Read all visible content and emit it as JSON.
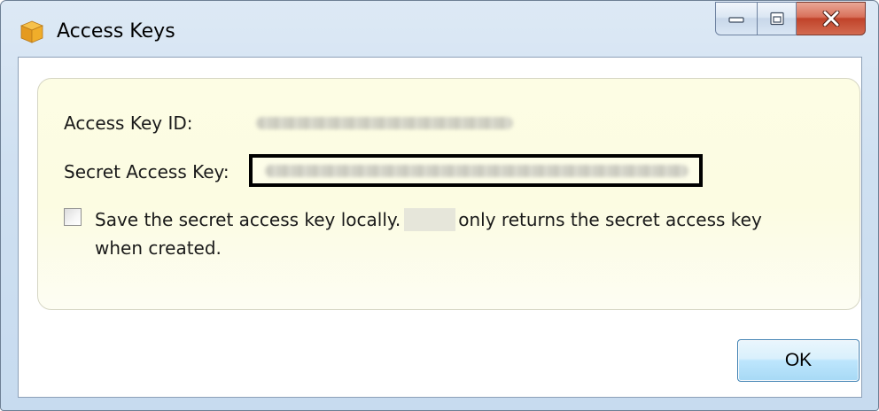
{
  "window": {
    "title": "Access Keys",
    "app_icon": "box-icon",
    "caption_buttons": [
      "minimize-icon",
      "maximize-icon",
      "close-icon"
    ]
  },
  "form": {
    "access_key_id_label": "Access Key ID:",
    "secret_access_key_label": "Secret Access Key:",
    "save_checkbox": {
      "checked": false,
      "label_part1": "Save the secret access key locally.",
      "label_part2": "only returns the secret access key when created."
    }
  },
  "buttons": {
    "ok_label": "OK"
  },
  "colors": {
    "panel_background": "#fcfce2",
    "ok_button_border": "#3c7fb1",
    "close_button": "#c0432a"
  }
}
